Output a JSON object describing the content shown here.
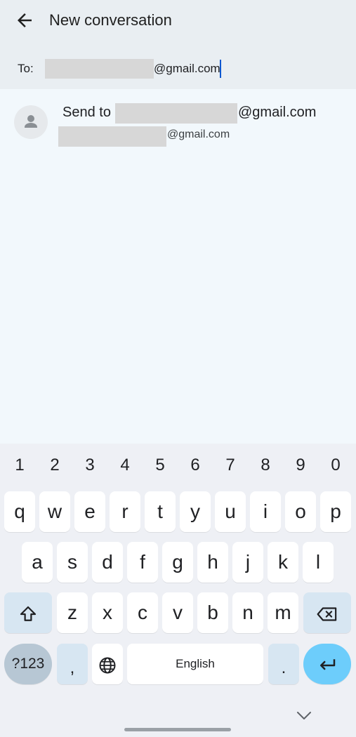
{
  "header": {
    "title": "New conversation",
    "to_label": "To:",
    "to_domain": "@gmail.com"
  },
  "suggestion": {
    "send_prefix": "Send to",
    "send_domain": "@gmail.com",
    "sub_domain": "@gmail.com"
  },
  "keyboard": {
    "numbers": [
      "1",
      "2",
      "3",
      "4",
      "5",
      "6",
      "7",
      "8",
      "9",
      "0"
    ],
    "row1": [
      "q",
      "w",
      "e",
      "r",
      "t",
      "y",
      "u",
      "i",
      "o",
      "p"
    ],
    "row2": [
      "a",
      "s",
      "d",
      "f",
      "g",
      "h",
      "j",
      "k",
      "l"
    ],
    "row3": [
      "z",
      "x",
      "c",
      "v",
      "b",
      "n",
      "m"
    ],
    "symbols_label": "?123",
    "comma_label": ",",
    "space_label": "English",
    "period_label": ".",
    "icons": {
      "shift": "shift-icon",
      "backspace": "backspace-icon",
      "globe": "globe-icon",
      "enter": "enter-icon",
      "hide": "chevron-down-icon"
    }
  },
  "colors": {
    "header_bg": "#e9eef2",
    "content_bg": "#f2f8fc",
    "keyboard_bg": "#eef0f5",
    "accent": "#0b57d0",
    "enter_key": "#6dcdfb"
  }
}
